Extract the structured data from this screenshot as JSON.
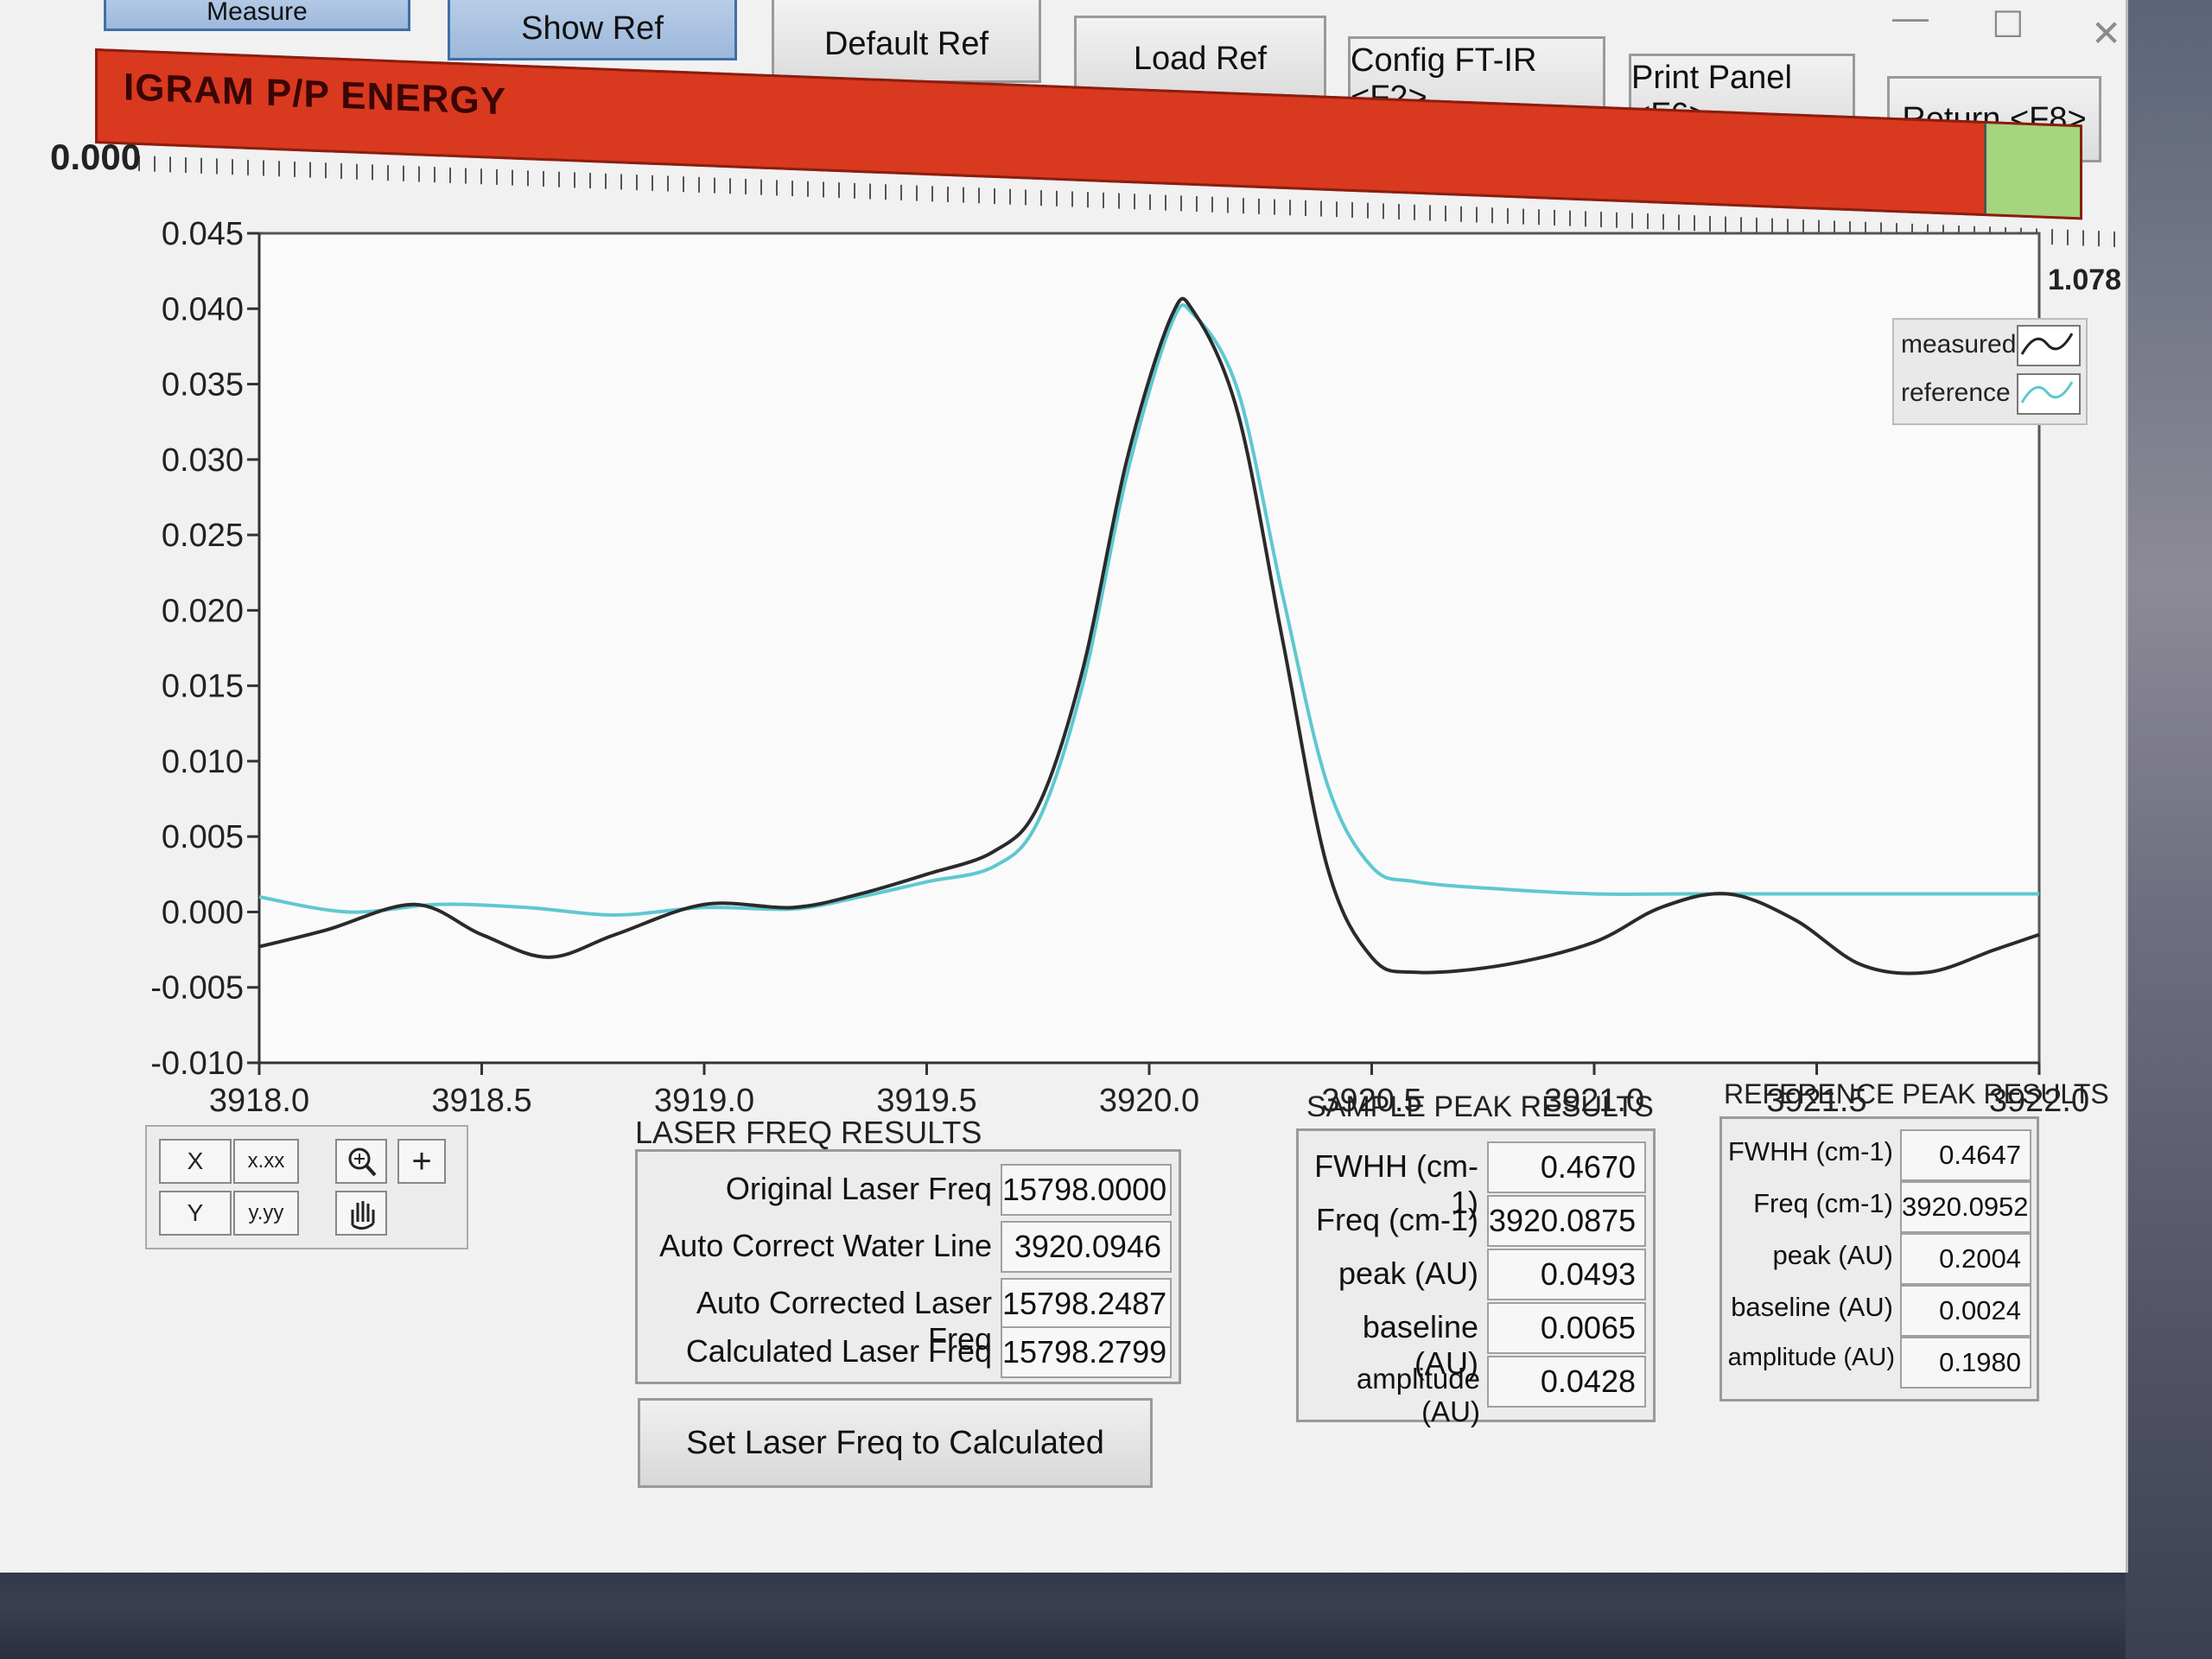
{
  "toolbar": {
    "measure_label": "Measure",
    "show_ref_label": "Show Ref",
    "default_ref_label": "Default Ref",
    "load_ref_label": "Load Ref",
    "config_label": "Config FT-IR <F2>",
    "print_label": "Print Panel <F6>",
    "return_label": "Return <F8>"
  },
  "energy": {
    "title": "IGRAM P/P ENERGY",
    "min_label": "0.000",
    "max_label": "1.078",
    "bar_colors": {
      "fill": "#d9391f",
      "end": "#a6d57f"
    }
  },
  "legend": {
    "measured": "measured",
    "reference": "reference"
  },
  "chart_data": {
    "type": "line",
    "xlim": [
      3918.0,
      3922.0
    ],
    "ylim": [
      -0.01,
      0.045
    ],
    "x_ticks": [
      "3918.0",
      "3918.5",
      "3919.0",
      "3919.5",
      "3920.0",
      "3920.5",
      "3921.0",
      "3921.5",
      "3922.0"
    ],
    "y_ticks": [
      "0.045",
      "0.040",
      "0.035",
      "0.030",
      "0.025",
      "0.020",
      "0.015",
      "0.010",
      "0.005",
      "0.000",
      "-0.005",
      "-0.010"
    ],
    "series": [
      {
        "name": "measured",
        "color": "#2a2a2a",
        "x": [
          3918.0,
          3918.15,
          3918.35,
          3918.5,
          3918.65,
          3918.8,
          3919.0,
          3919.2,
          3919.35,
          3919.5,
          3919.65,
          3919.75,
          3919.85,
          3919.95,
          3920.05,
          3920.1,
          3920.2,
          3920.3,
          3920.4,
          3920.5,
          3920.6,
          3920.8,
          3921.0,
          3921.15,
          3921.3,
          3921.45,
          3921.6,
          3921.75,
          3921.9,
          3922.0
        ],
        "y": [
          -0.0023,
          -0.0012,
          0.0005,
          -0.0015,
          -0.003,
          -0.0015,
          0.0005,
          0.0003,
          0.0012,
          0.0025,
          0.004,
          0.007,
          0.016,
          0.03,
          0.0395,
          0.0398,
          0.033,
          0.018,
          0.003,
          -0.003,
          -0.004,
          -0.0035,
          -0.002,
          0.0003,
          0.0012,
          -0.0005,
          -0.0035,
          -0.004,
          -0.0025,
          -0.0015
        ]
      },
      {
        "name": "reference",
        "color": "#5ec8d0",
        "x": [
          3918.0,
          3918.2,
          3918.4,
          3918.6,
          3918.8,
          3919.0,
          3919.2,
          3919.35,
          3919.5,
          3919.65,
          3919.75,
          3919.85,
          3919.95,
          3920.05,
          3920.1,
          3920.2,
          3920.3,
          3920.4,
          3920.5,
          3920.6,
          3920.8,
          3921.0,
          3921.2,
          3921.4,
          3921.6,
          3921.8,
          3922.0
        ],
        "y": [
          0.001,
          0.0,
          0.0005,
          0.0003,
          -0.0002,
          0.0003,
          0.0002,
          0.001,
          0.002,
          0.003,
          0.006,
          0.015,
          0.029,
          0.039,
          0.0396,
          0.0345,
          0.021,
          0.0085,
          0.003,
          0.002,
          0.0015,
          0.0012,
          0.0012,
          0.0012,
          0.0012,
          0.0012,
          0.0012
        ]
      }
    ]
  },
  "laser": {
    "title": "LASER FREQ RESULTS",
    "rows": [
      {
        "label": "Original Laser Freq",
        "value": "15798.0000"
      },
      {
        "label": "Auto Correct Water Line",
        "value": "3920.0946"
      },
      {
        "label": "Auto Corrected Laser Freq",
        "value": "15798.2487"
      },
      {
        "label": "Calculated Laser Freq",
        "value": "15798.2799"
      }
    ],
    "button_label": "Set Laser Freq to Calculated"
  },
  "sample": {
    "title": "SAMPLE PEAK RESULTS",
    "rows": [
      {
        "label": "FWHH (cm-1)",
        "value": "0.4670"
      },
      {
        "label": "Freq (cm-1)",
        "value": "3920.0875"
      },
      {
        "label": "peak (AU)",
        "value": "0.0493"
      },
      {
        "label": "baseline (AU)",
        "value": "0.0065"
      },
      {
        "label": "amplitude (AU)",
        "value": "0.0428"
      }
    ]
  },
  "reference": {
    "title": "REFERENCE PEAK RESULTS",
    "rows": [
      {
        "label": "FWHH (cm-1)",
        "value": "0.4647"
      },
      {
        "label": "Freq (cm-1)",
        "value": "3920.0952"
      },
      {
        "label": "peak (AU)",
        "value": "0.2004"
      },
      {
        "label": "baseline (AU)",
        "value": "0.0024"
      },
      {
        "label": "amplitude (AU)",
        "value": "0.1980"
      }
    ]
  },
  "palette": {
    "x_format": "x.xx",
    "y_format": "y.yy",
    "x_axis": "X",
    "y_axis": "Y"
  },
  "window_controls": {
    "minimize": "—",
    "maximize": "☐",
    "close": "✕"
  }
}
